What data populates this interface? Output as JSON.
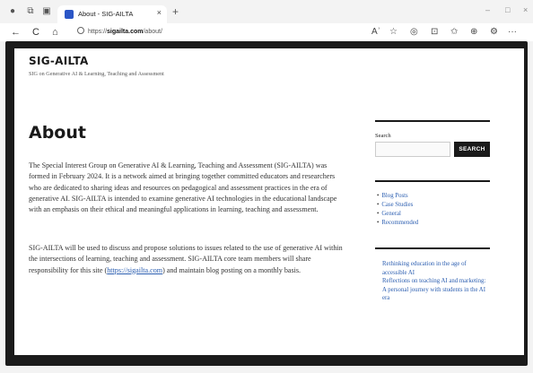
{
  "browser": {
    "tab_title": "About - SIG-AILTA",
    "tab_close": "×",
    "new_tab": "+",
    "minimize": "–",
    "maximize": "□",
    "close": "×",
    "back": "←",
    "reload": "C",
    "home": "⌂",
    "url_domain": "sigailta.com",
    "url_prefix": "https://",
    "url_path": "/about/",
    "read_aloud": "Aʾ",
    "favorites": "☆",
    "split": "⊡",
    "more": "···"
  },
  "site": {
    "title": "SIG-AILTA",
    "description": "SIG on Generative AI & Learning, Teaching and Assessment"
  },
  "main": {
    "page_title": "About",
    "para1": "The Special Interest Group on Generative AI & Learning, Teaching and Assessment (SIG-AILTA) was formed in February 2024. It is a network aimed at bringing together committed educators and researchers who are dedicated to sharing ideas and resources on pedagogical and assessment practices in the era of generative AI. SIG-AILTA is intended to examine generative AI technologies in the educational landscape with an emphasis on their ethical and meaningful applications in learning, teaching and assessment.",
    "para2_before": "SIG-AILTA will be used to discuss and propose solutions to issues related to the use of generative AI within the intersections of learning, teaching and assessment. SIG-AILTA core team members will share responsibility for this site (",
    "para2_link": "https://sigailta.com",
    "para2_after": ") and maintain blog posting on a monthly basis."
  },
  "sidebar": {
    "search_label": "Search",
    "search_value": "",
    "search_button": "SEARCH",
    "categories": [
      "Blog Posts",
      "Case Studies",
      "General",
      "Recommended"
    ],
    "recent": [
      "Rethinking education in the age of accessible AI",
      "Reflections on teaching AI and marketing: A personal journey with students in the AI era"
    ]
  }
}
